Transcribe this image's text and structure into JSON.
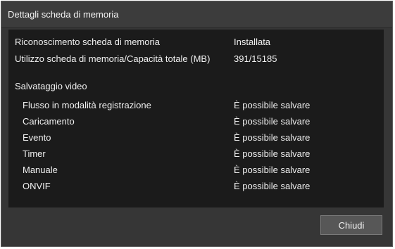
{
  "dialog": {
    "title": "Dettagli scheda di memoria"
  },
  "info": {
    "recognition_label": "Riconoscimento scheda di memoria",
    "recognition_value": "Installata",
    "usage_label": "Utilizzo scheda di memoria/Capacità totale (MB)",
    "usage_value": "391/15185"
  },
  "video_saving": {
    "heading": "Salvataggio video",
    "items": [
      {
        "label": "Flusso in modalità registrazione",
        "status": "È possibile salvare"
      },
      {
        "label": "Caricamento",
        "status": "È possibile salvare"
      },
      {
        "label": "Evento",
        "status": "È possibile salvare"
      },
      {
        "label": "Timer",
        "status": "È possibile salvare"
      },
      {
        "label": "Manuale",
        "status": "È possibile salvare"
      },
      {
        "label": "ONVIF",
        "status": "È possibile salvare"
      }
    ]
  },
  "footer": {
    "close_label": "Chiudi"
  }
}
